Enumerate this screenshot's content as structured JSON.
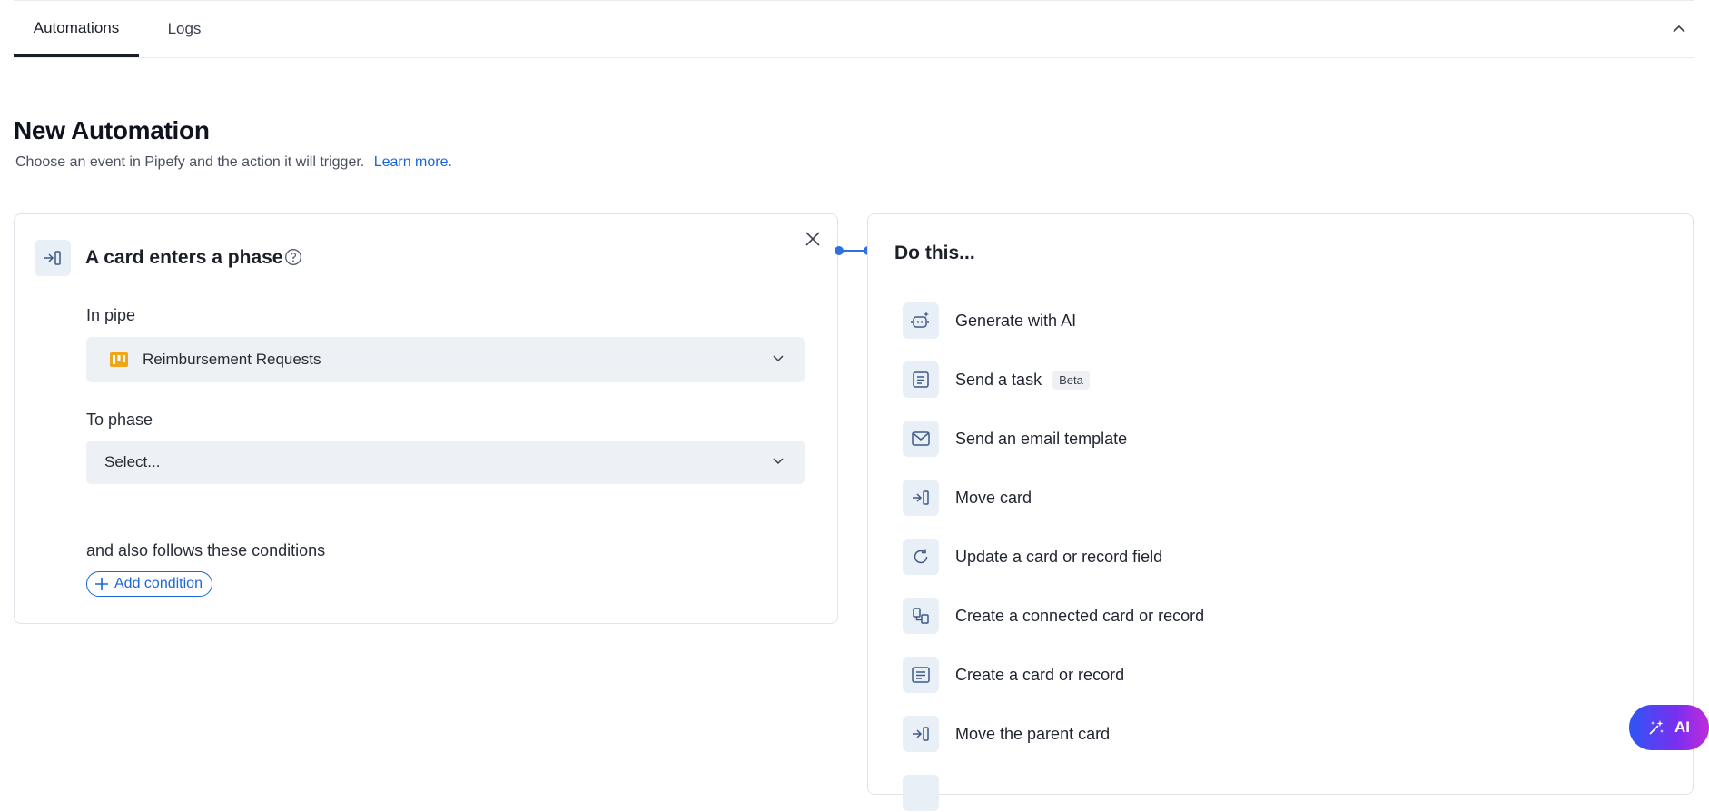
{
  "tabs": [
    {
      "label": "Automations",
      "active": true
    },
    {
      "label": "Logs",
      "active": false
    }
  ],
  "header": {
    "title": "New Automation",
    "subtitle": "Choose an event in Pipefy and the action it will trigger.",
    "learn_more": "Learn more."
  },
  "trigger": {
    "title": "A card enters a phase",
    "pipe_label": "In pipe",
    "pipe_value": "Reimbursement Requests",
    "phase_label": "To phase",
    "phase_placeholder": "Select...",
    "conditions_label": "and also follows these conditions",
    "add_condition": "Add condition"
  },
  "actions": {
    "title": "Do this...",
    "items": [
      {
        "label": "Generate with AI",
        "icon": "ai-robot-icon"
      },
      {
        "label": "Send a task",
        "icon": "task-icon",
        "badge": "Beta"
      },
      {
        "label": "Send an email template",
        "icon": "envelope-icon"
      },
      {
        "label": "Move card",
        "icon": "move-card-icon"
      },
      {
        "label": "Update a card or record field",
        "icon": "refresh-icon"
      },
      {
        "label": "Create a connected card or record",
        "icon": "connected-cards-icon"
      },
      {
        "label": "Create a card or record",
        "icon": "card-icon"
      },
      {
        "label": "Move the parent card",
        "icon": "move-card-icon"
      }
    ]
  },
  "ai_button": {
    "label": "AI"
  },
  "colors": {
    "accent": "#1a66d9",
    "pipe_icon": "#f2a516",
    "icon_bg": "#e9eff7",
    "select_bg": "#edf0f4"
  }
}
